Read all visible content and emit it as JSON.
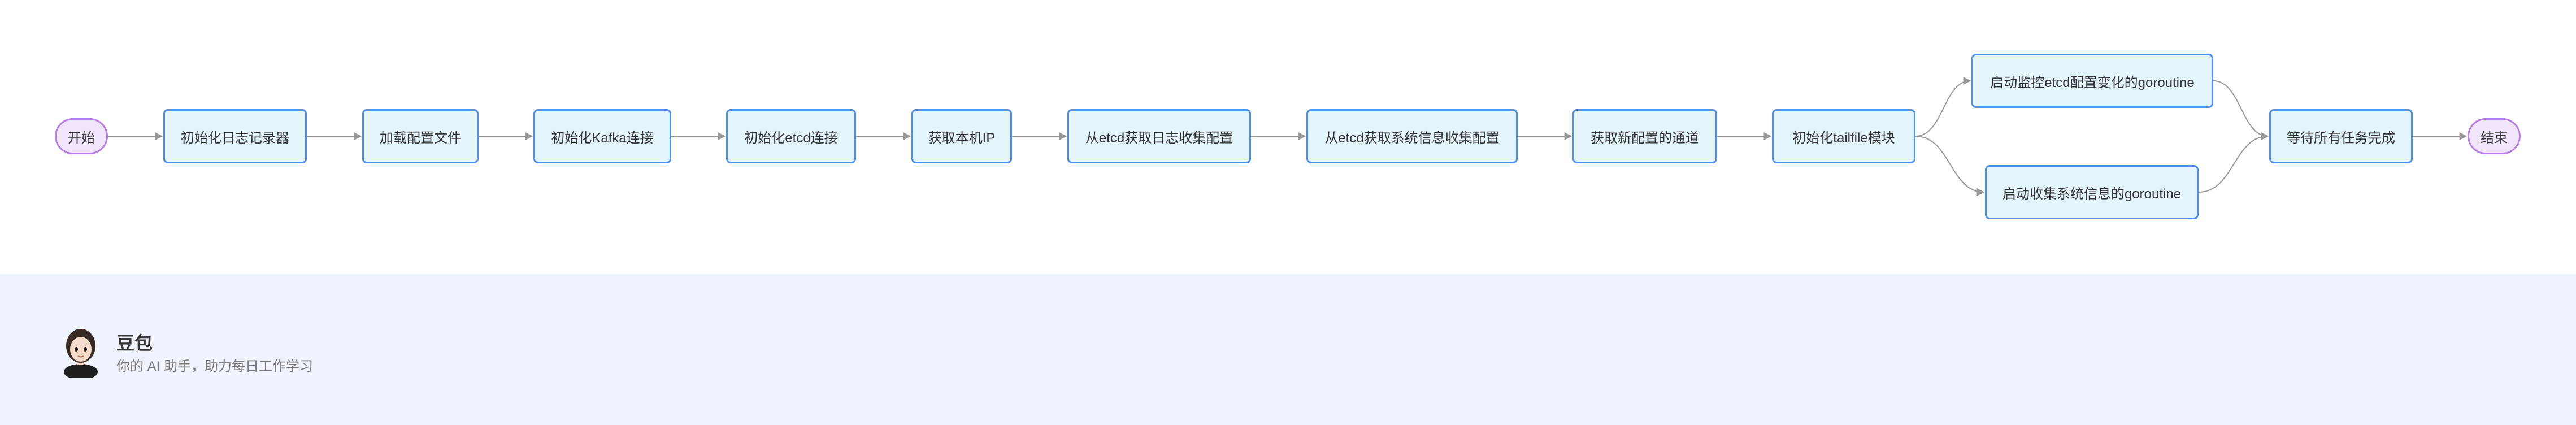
{
  "diagram": {
    "nodes": [
      {
        "id": "start",
        "label": "开始",
        "kind": "terminal"
      },
      {
        "id": "n1",
        "label": "初始化日志记录器",
        "kind": "process"
      },
      {
        "id": "n2",
        "label": "加载配置文件",
        "kind": "process"
      },
      {
        "id": "n3",
        "label": "初始化Kafka连接",
        "kind": "process"
      },
      {
        "id": "n4",
        "label": "初始化etcd连接",
        "kind": "process"
      },
      {
        "id": "n5",
        "label": "获取本机IP",
        "kind": "process"
      },
      {
        "id": "n6",
        "label": "从etcd获取日志收集配置",
        "kind": "process"
      },
      {
        "id": "n7",
        "label": "从etcd获取系统信息收集配置",
        "kind": "process"
      },
      {
        "id": "n8",
        "label": "获取新配置的通道",
        "kind": "process"
      },
      {
        "id": "n9",
        "label": "初始化tailfile模块",
        "kind": "process"
      },
      {
        "id": "n10",
        "label": "启动监控etcd配置变化的goroutine",
        "kind": "process"
      },
      {
        "id": "n11",
        "label": "启动收集系统信息的goroutine",
        "kind": "process"
      },
      {
        "id": "n12",
        "label": "等待所有任务完成",
        "kind": "process"
      },
      {
        "id": "end",
        "label": "结束",
        "kind": "terminal"
      }
    ],
    "edges": [
      {
        "from": "start",
        "to": "n1"
      },
      {
        "from": "n1",
        "to": "n2"
      },
      {
        "from": "n2",
        "to": "n3"
      },
      {
        "from": "n3",
        "to": "n4"
      },
      {
        "from": "n4",
        "to": "n5"
      },
      {
        "from": "n5",
        "to": "n6"
      },
      {
        "from": "n6",
        "to": "n7"
      },
      {
        "from": "n7",
        "to": "n8"
      },
      {
        "from": "n8",
        "to": "n9"
      },
      {
        "from": "n9",
        "to": "n10"
      },
      {
        "from": "n9",
        "to": "n11"
      },
      {
        "from": "n10",
        "to": "n12"
      },
      {
        "from": "n11",
        "to": "n12"
      },
      {
        "from": "n12",
        "to": "end"
      }
    ],
    "colors": {
      "process_fill": "#e3f4fb",
      "process_border": "#4f8fe8",
      "terminal_fill": "#f1e5fb",
      "terminal_border": "#b77ee6",
      "edge": "#999999",
      "text": "#333333"
    }
  },
  "footer": {
    "brand_name": "豆包",
    "tagline": "你的 AI 助手，助力每日工作学习",
    "avatar_icon": "doubao-avatar",
    "background": "#eff3fb"
  }
}
